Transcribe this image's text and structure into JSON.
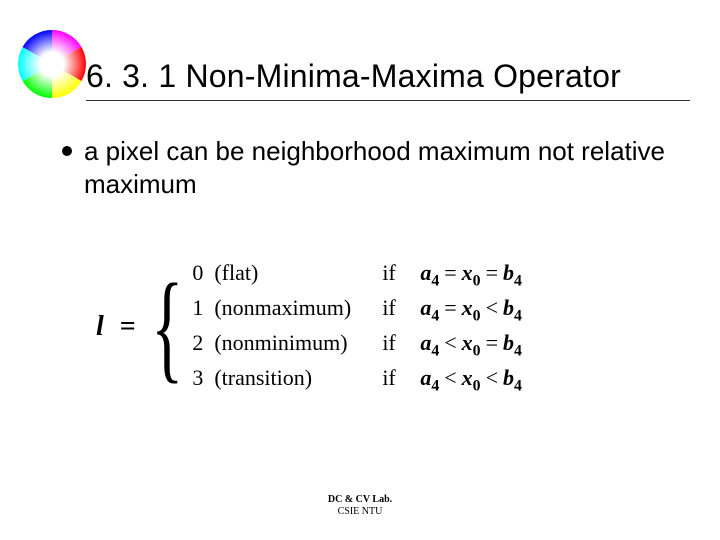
{
  "title": "6. 3. 1 Non-Minima-Maxima Operator",
  "bullet": "a pixel can be neighborhood maximum not relative maximum",
  "formula": {
    "lhs": "l",
    "eq": "=",
    "cases": [
      {
        "num": "0",
        "label": "(flat)",
        "if": "if",
        "a": "a",
        "asub": "4",
        "rel1": "=",
        "x": "x",
        "xsub": "0",
        "rel2": "=",
        "b": "b",
        "bsub": "4"
      },
      {
        "num": "1",
        "label": "(nonmaximum)",
        "if": "if",
        "a": "a",
        "asub": "4",
        "rel1": "=",
        "x": "x",
        "xsub": "0",
        "rel2": "<",
        "b": "b",
        "bsub": "4"
      },
      {
        "num": "2",
        "label": "(nonminimum)",
        "if": "if",
        "a": "a",
        "asub": "4",
        "rel1": "<",
        "x": "x",
        "xsub": "0",
        "rel2": "=",
        "b": "b",
        "bsub": "4"
      },
      {
        "num": "3",
        "label": "(transition)",
        "if": "if",
        "a": "a",
        "asub": "4",
        "rel1": "<",
        "x": "x",
        "xsub": "0",
        "rel2": "<",
        "b": "b",
        "bsub": "4"
      }
    ]
  },
  "footer": {
    "line1": "DC & CV Lab.",
    "line2": "CSIE NTU"
  }
}
